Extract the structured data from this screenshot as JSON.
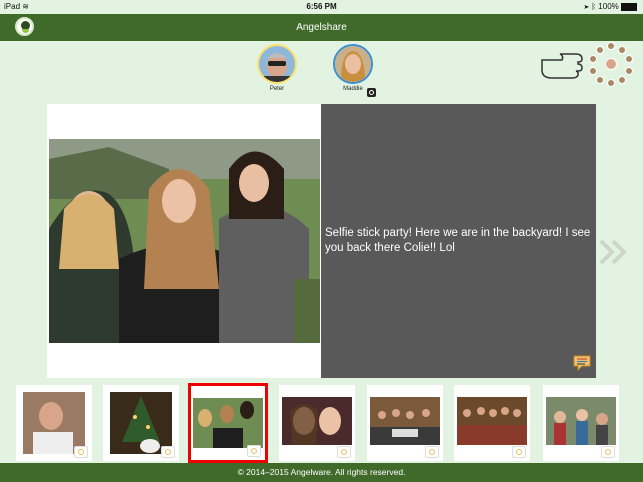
{
  "status": {
    "device": "iPad",
    "time": "6:56 PM",
    "battery": "100%"
  },
  "nav": {
    "title": "Angelshare"
  },
  "people": [
    {
      "name": "Peter"
    },
    {
      "name": "Maddie"
    }
  ],
  "post": {
    "caption": "Selfie stick party! Here we are in the backyard! I see you back there Colie!! Lol"
  },
  "footer": {
    "copyright": "© 2014–2015 Angelware. All rights reserved."
  },
  "colors": {
    "nav_bg": "#3f6a2a",
    "page_bg": "#e3f3e2",
    "caption_bg": "#595959",
    "selected_border": "#e00000"
  }
}
